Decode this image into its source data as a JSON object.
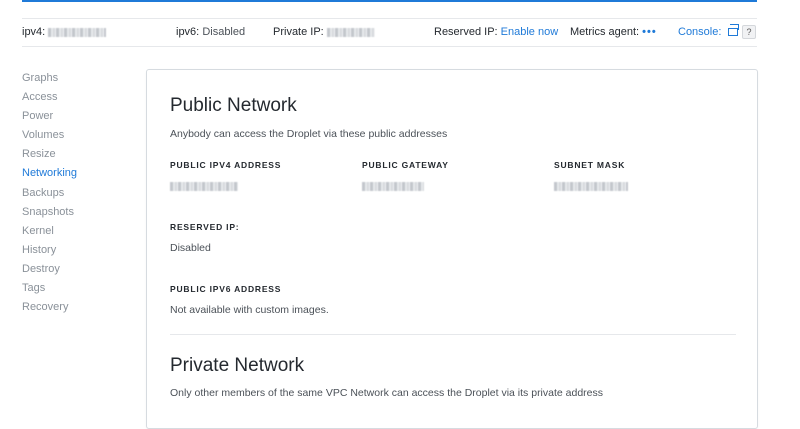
{
  "infobar": {
    "ipv4_label": "ipv4:",
    "ipv6_label": "ipv6:",
    "ipv6_value": "Disabled",
    "private_ip_label": "Private IP:",
    "reserved_ip_label": "Reserved IP:",
    "reserved_ip_action": "Enable now",
    "metrics_label": "Metrics agent:",
    "metrics_value": "•••",
    "console_label": "Console:",
    "help_label": "?"
  },
  "sidebar": {
    "items": [
      {
        "label": "Graphs"
      },
      {
        "label": "Access"
      },
      {
        "label": "Power"
      },
      {
        "label": "Volumes"
      },
      {
        "label": "Resize"
      },
      {
        "label": "Networking"
      },
      {
        "label": "Backups"
      },
      {
        "label": "Snapshots"
      },
      {
        "label": "Kernel"
      },
      {
        "label": "History"
      },
      {
        "label": "Destroy"
      },
      {
        "label": "Tags"
      },
      {
        "label": "Recovery"
      }
    ],
    "active_index": 5
  },
  "public_network": {
    "title": "Public Network",
    "description": "Anybody can access the Droplet via these public addresses",
    "ipv4_caption": "PUBLIC IPV4 ADDRESS",
    "gateway_caption": "PUBLIC GATEWAY",
    "subnet_caption": "SUBNET MASK",
    "reserved_caption": "RESERVED IP:",
    "reserved_value": "Disabled",
    "ipv6_caption": "PUBLIC IPV6 ADDRESS",
    "ipv6_value": "Not available with custom images."
  },
  "private_network": {
    "title": "Private Network",
    "description": "Only other members of the same VPC Network can access the Droplet via its private address"
  },
  "colors": {
    "accent": "#1f7ad8",
    "muted_text": "#8a9199",
    "border": "#d6dbe0"
  }
}
